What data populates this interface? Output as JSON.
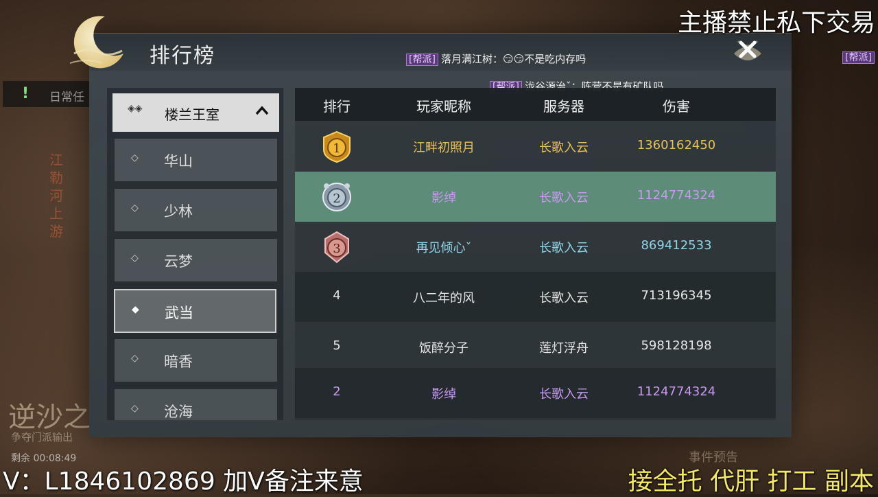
{
  "overlay": {
    "top_right": "主播禁止私下交易",
    "bottom_left": "V：L1846102869 加V备注来意",
    "bottom_right": "接全托 代肝 打工 副本"
  },
  "background": {
    "quest_label": "日常任",
    "vertical_text": "江勒河上游",
    "event_title": "逆沙之",
    "event_sub": "争夺门派输出",
    "timer": "剩余 00:08:49",
    "event_preview": "事件预告"
  },
  "panel": {
    "title": "排行榜",
    "chat": [
      {
        "tag": "[帮派]",
        "text": "落月满江树：😏😏不是吃内存吗"
      },
      {
        "tag": "[帮派]",
        "text": "泷谷源治ˇ：阵营不是有矿队吗"
      },
      {
        "tag": "[帮派]",
        "text": ""
      }
    ]
  },
  "sidebar": {
    "header": "楼兰王室",
    "items": [
      {
        "label": "华山"
      },
      {
        "label": "少林"
      },
      {
        "label": "云梦"
      },
      {
        "label": "武当"
      },
      {
        "label": "暗香"
      },
      {
        "label": "沧海"
      }
    ],
    "active_index": 3
  },
  "table": {
    "headers": [
      "排行",
      "玩家昵称",
      "服务器",
      "伤害"
    ],
    "rows": [
      {
        "rank": "1",
        "name": "江畔初照月",
        "server": "长歌入云",
        "damage": "1360162450"
      },
      {
        "rank": "2",
        "name": "影绰",
        "server": "长歌入云",
        "damage": "1124774324"
      },
      {
        "rank": "3",
        "name": "再见倾心ˇ",
        "server": "长歌入云",
        "damage": "869412533"
      },
      {
        "rank": "4",
        "name": "八二年的风",
        "server": "长歌入云",
        "damage": "713196345"
      },
      {
        "rank": "5",
        "name": "饭醉分子",
        "server": "莲灯浮舟",
        "damage": "598128198"
      },
      {
        "rank": "2",
        "name": "影绰",
        "server": "长歌入云",
        "damage": "1124774324"
      }
    ]
  },
  "colors": {
    "gold": "#e8c15a",
    "highlight_row": "#5d8c78",
    "cyan": "#8fd6e8",
    "white": "#e6e6e6",
    "purple": "#c79af0"
  }
}
